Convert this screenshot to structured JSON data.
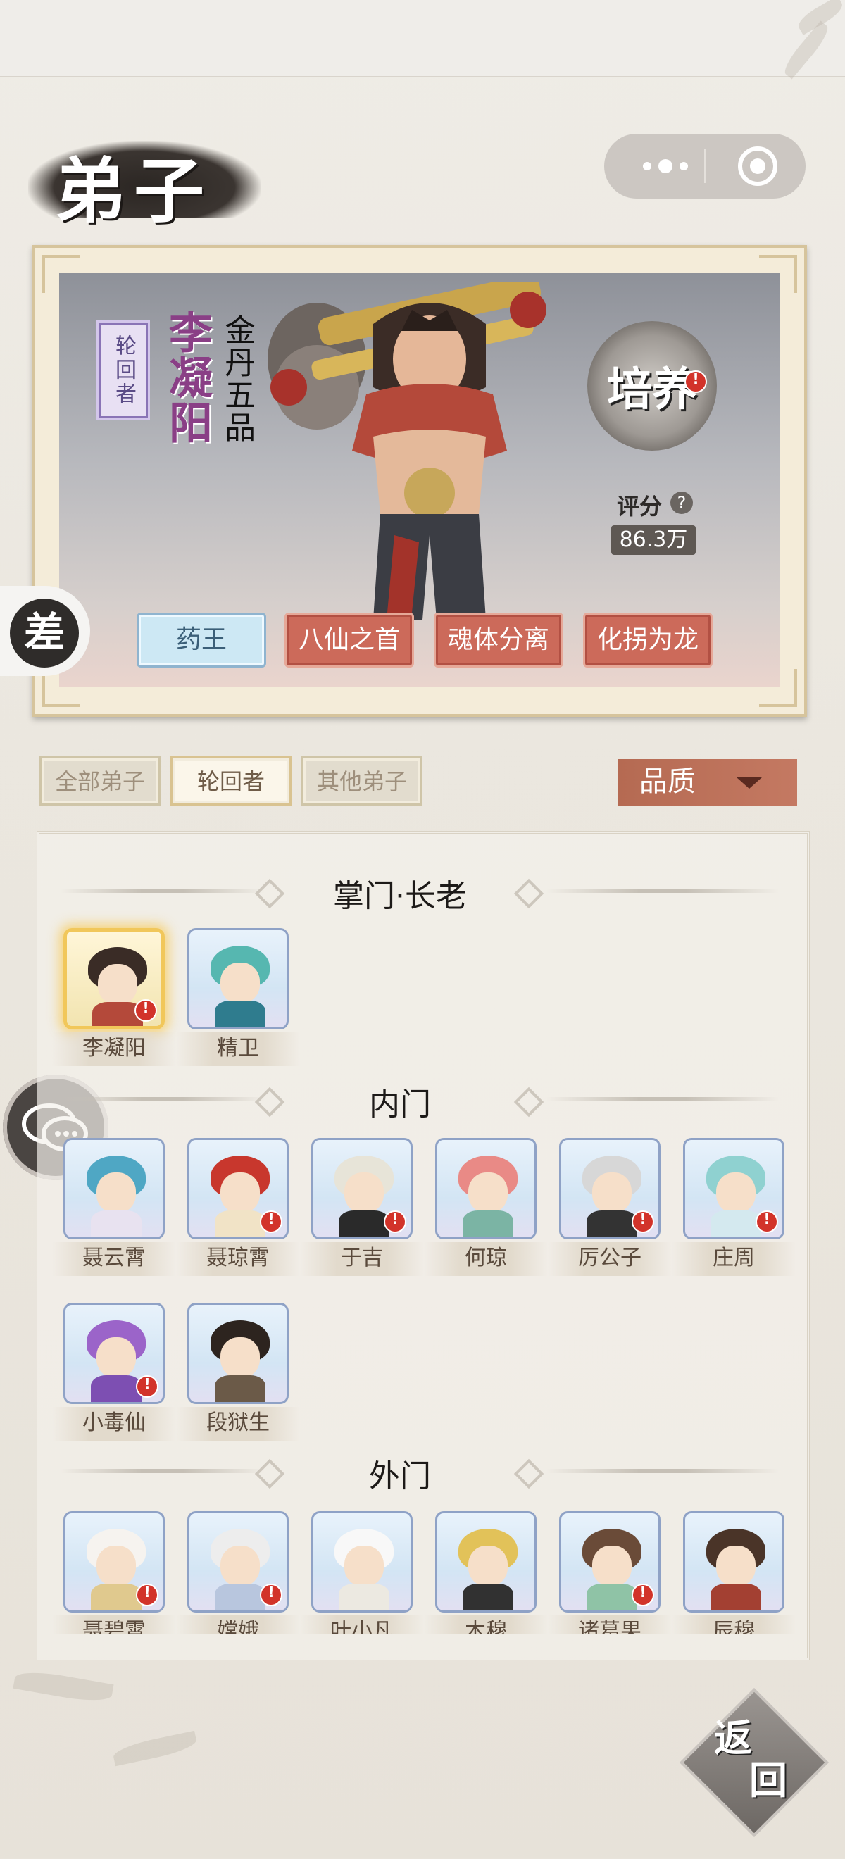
{
  "page_title": "弟子",
  "hero": {
    "reincarnation_badge": "轮回者",
    "name": "李凝阳",
    "rank": "金丹五品",
    "cultivate_label": "培养",
    "score_label": "评分",
    "score_help": "?",
    "score_value": "86.3万",
    "traits": [
      "药王",
      "八仙之首",
      "魂体分离",
      "化拐为龙"
    ]
  },
  "floating": {
    "difference_label": "差",
    "return_label": "返回"
  },
  "filters": {
    "tabs": [
      "全部弟子",
      "轮回者",
      "其他弟子"
    ],
    "active_tab": "轮回者",
    "sort_label": "品质"
  },
  "sections": [
    {
      "title": "掌门·长老",
      "disciples": [
        "李凝阳",
        "精卫"
      ]
    },
    {
      "title": "内门",
      "disciples": [
        "聂云霄",
        "聂琼霄",
        "于吉",
        "何琼",
        "厉公子",
        "庄周",
        "小毒仙",
        "段狱生"
      ]
    },
    {
      "title": "外门",
      "disciples": [
        "聂碧霄",
        "嫦娥",
        "叶小凡",
        "木穆",
        "诸葛果",
        "辰穆"
      ]
    }
  ],
  "colors": {
    "accent": "#cc6a5a",
    "selected_glow": "#f1c75a",
    "alert": "#d2332a"
  }
}
